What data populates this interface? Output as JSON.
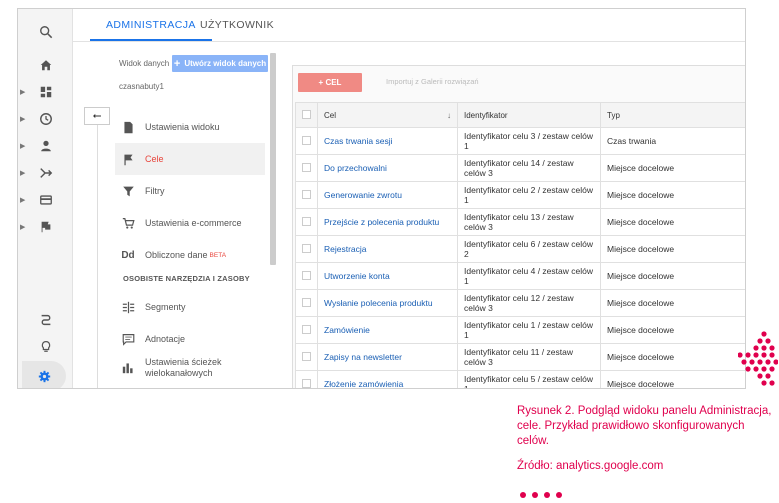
{
  "tabs": [
    "ADMINISTRACJA",
    "UŻYTKOWNIK"
  ],
  "view": {
    "label": "Widok danych",
    "create_button": "Utwórz widok danych",
    "name": "czasnabuty1"
  },
  "menu": {
    "items": [
      {
        "label": "Ustawienia widoku",
        "icon": "document-icon"
      },
      {
        "label": "Cele",
        "icon": "flag-icon"
      },
      {
        "label": "Filtry",
        "icon": "filter-icon"
      },
      {
        "label": "Ustawienia e-commerce",
        "icon": "cart-icon"
      },
      {
        "label": "Obliczone dane",
        "icon": "dd-icon",
        "badge": "BETA"
      }
    ],
    "section_title": "OSOBISTE NARZĘDZIA I ZASOBY",
    "tools": [
      {
        "label": "Segmenty",
        "icon": "segments-icon"
      },
      {
        "label": "Adnotacje",
        "icon": "annotation-icon"
      },
      {
        "label": "Ustawienia ścieżek wielokanałowych",
        "icon": "bar-chart-icon"
      }
    ]
  },
  "goals": {
    "add_button": "+ CEL",
    "import_button": "Importuj z Galerii rozwiązań",
    "columns": [
      "Cel",
      "Identyfikator",
      "Typ"
    ],
    "rows": [
      {
        "name": "Czas trwania sesji",
        "id": "Identyfikator celu 3 / zestaw celów 1",
        "type": "Czas trwania"
      },
      {
        "name": "Do przechowalni",
        "id": "Identyfikator celu 14 / zestaw celów 3",
        "type": "Miejsce docelowe"
      },
      {
        "name": "Generowanie zwrotu",
        "id": "Identyfikator celu 2 / zestaw celów 1",
        "type": "Miejsce docelowe"
      },
      {
        "name": "Przejście z polecenia produktu",
        "id": "Identyfikator celu 13 / zestaw celów 3",
        "type": "Miejsce docelowe"
      },
      {
        "name": "Rejestracja",
        "id": "Identyfikator celu 6 / zestaw celów 2",
        "type": "Miejsce docelowe"
      },
      {
        "name": "Utworzenie konta",
        "id": "Identyfikator celu 4 / zestaw celów 1",
        "type": "Miejsce docelowe"
      },
      {
        "name": "Wysłanie polecenia produktu",
        "id": "Identyfikator celu 12 / zestaw celów 3",
        "type": "Miejsce docelowe"
      },
      {
        "name": "Zamówienie",
        "id": "Identyfikator celu 1 / zestaw celów 1",
        "type": "Miejsce docelowe"
      },
      {
        "name": "Zapisy na newsletter",
        "id": "Identyfikator celu 11 / zestaw celów 3",
        "type": "Miejsce docelowe"
      },
      {
        "name": "Złożenie zamówienia",
        "id": "Identyfikator celu 5 / zestaw celów 1",
        "type": "Miejsce docelowe"
      }
    ]
  },
  "caption": {
    "text": "Rysunek 2. Podgląd widoku panelu Administracja, cele. Przykład prawidłowo skonfigurowanych celów.",
    "source": "Źródło: analytics.google.com"
  },
  "colors": {
    "accent": "#1a73e8",
    "active": "#e8453c",
    "caption": "#e0004d"
  }
}
